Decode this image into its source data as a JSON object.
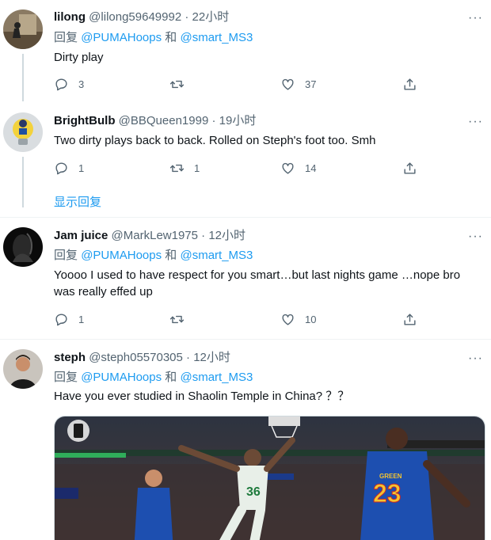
{
  "reply_prefix": "回复",
  "reply_and": "和",
  "tweets": [
    {
      "name": "lilong",
      "handle": "@lilong59649992",
      "time": "22小时",
      "reply_to": [
        "@PUMAHoops",
        "@smart_MS3"
      ],
      "text": "Dirty play",
      "reply_count": "3",
      "retweet_count": "",
      "like_count": "37"
    },
    {
      "name": "BrightBulb",
      "handle": "@BBQueen1999",
      "time": "19小时",
      "text": "Two dirty plays back to back. Rolled on Steph's foot too.  Smh",
      "reply_count": "1",
      "retweet_count": "1",
      "like_count": "14",
      "show_replies": "显示回复"
    },
    {
      "name": "Jam juice",
      "handle": "@MarkLew1975",
      "time": "12小时",
      "reply_to": [
        "@PUMAHoops",
        "@smart_MS3"
      ],
      "text": "Yoooo I used to have respect for you smart…but last nights game …nope bro was really effed up",
      "reply_count": "1",
      "retweet_count": "",
      "like_count": "10"
    },
    {
      "name": "steph",
      "handle": "@steph05570305",
      "time": "12小时",
      "reply_to": [
        "@PUMAHoops",
        "@smart_MS3"
      ],
      "text": "Have you ever studied in Shaolin Temple in China? ？？",
      "media": {
        "jersey_left": "36",
        "jersey_right": "23",
        "jersey_right_name": "GREEN"
      }
    }
  ],
  "separator": " · ",
  "more_glyph": "···",
  "icons": [
    "reply-icon",
    "retweet-icon",
    "like-icon",
    "share-icon",
    "more-icon"
  ],
  "colors": {
    "link": "#1d9bf0",
    "muted": "#536471",
    "text": "#0f1419"
  }
}
